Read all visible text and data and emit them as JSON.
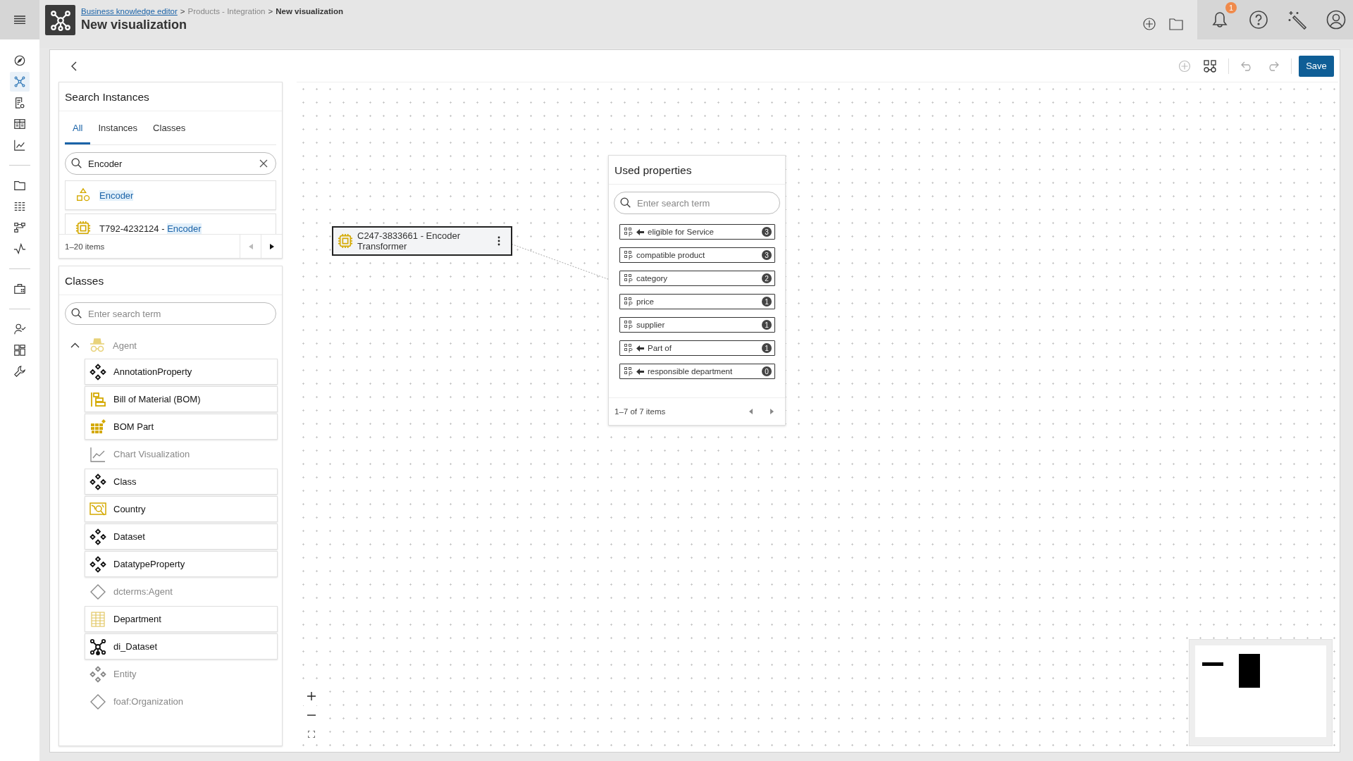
{
  "app_bar": {
    "breadcrumbs": [
      {
        "kind": "link",
        "label": "Business knowledge editor"
      },
      {
        "kind": "separator",
        "label": ">"
      },
      {
        "kind": "text",
        "label": "Products - Integration"
      },
      {
        "kind": "separator",
        "label": ">"
      },
      {
        "kind": "current",
        "label": "New visualization"
      }
    ],
    "title": "New visualization",
    "notification_count": "1"
  },
  "nav_groups": [
    [
      {
        "kind": "compass",
        "selected": false
      },
      {
        "kind": "network",
        "selected": true
      },
      {
        "kind": "doc-eye",
        "selected": false
      },
      {
        "kind": "table",
        "selected": false
      },
      {
        "kind": "chart",
        "selected": false
      }
    ],
    [
      {
        "kind": "folder",
        "selected": false
      },
      {
        "kind": "filters",
        "selected": false
      },
      {
        "kind": "flow",
        "selected": false
      },
      {
        "kind": "pulse",
        "selected": false
      }
    ],
    [
      {
        "kind": "briefcase",
        "selected": false
      }
    ],
    [
      {
        "kind": "user-check",
        "selected": false
      },
      {
        "kind": "widgets",
        "selected": false
      },
      {
        "kind": "wrench",
        "selected": false
      }
    ]
  ],
  "toolbar": {
    "save": "Save"
  },
  "search_instances": {
    "title": "Search Instances",
    "tabs": [
      {
        "label": "All",
        "selected": true
      },
      {
        "label": "Instances",
        "selected": false
      },
      {
        "label": "Classes",
        "selected": false
      }
    ],
    "search": {
      "value": "Encoder"
    },
    "results": [
      {
        "kind": "shapes",
        "parts": [
          {
            "text": "Encoder",
            "match": true
          }
        ]
      },
      {
        "kind": "chip",
        "parts": [
          {
            "text": "T792-4232124 - ",
            "match": false
          },
          {
            "text": "Encoder",
            "match": true
          }
        ]
      }
    ],
    "pager": "1–20 items"
  },
  "classes": {
    "title": "Classes",
    "search": {
      "placeholder": "Enter search term"
    },
    "tree": [
      {
        "label": "Agent",
        "kind": "agent",
        "enabled": false,
        "expanded": true,
        "children": [
          {
            "label": "AnnotationProperty",
            "kind": "diamonds",
            "enabled": true
          },
          {
            "label": "Bill of Material (BOM)",
            "kind": "bom",
            "enabled": true
          },
          {
            "label": "BOM Part",
            "kind": "bom-part",
            "enabled": true
          },
          {
            "label": "Chart Visualization",
            "kind": "chart",
            "enabled": false
          },
          {
            "label": "Class",
            "kind": "diamonds",
            "enabled": true
          },
          {
            "label": "Country",
            "kind": "country",
            "enabled": true
          },
          {
            "label": "Dataset",
            "kind": "diamonds",
            "enabled": true
          },
          {
            "label": "DatatypeProperty",
            "kind": "diamonds",
            "enabled": true
          },
          {
            "label": "dcterms:Agent",
            "kind": "diamond",
            "enabled": false
          },
          {
            "label": "Department",
            "kind": "department",
            "enabled": true
          },
          {
            "label": "di_Dataset",
            "kind": "network",
            "enabled": true
          },
          {
            "label": "Entity",
            "kind": "diamonds",
            "enabled": false
          },
          {
            "label": "foaf:Organization",
            "kind": "diamond",
            "enabled": false
          }
        ]
      }
    ]
  },
  "canvas": {
    "node": {
      "label": "C247-3833661 - Encoder Transformer",
      "kind": "chip"
    },
    "used_properties": {
      "title": "Used properties",
      "search": {
        "placeholder": "Enter search term"
      },
      "items": [
        {
          "label": "eligible for Service",
          "inverse": true,
          "count": "3"
        },
        {
          "label": "compatible product",
          "inverse": false,
          "count": "3"
        },
        {
          "label": "category",
          "inverse": false,
          "count": "2"
        },
        {
          "label": "price",
          "inverse": false,
          "count": "1"
        },
        {
          "label": "supplier",
          "inverse": false,
          "count": "1"
        },
        {
          "label": "Part of",
          "inverse": true,
          "count": "1"
        },
        {
          "label": "responsible department",
          "inverse": true,
          "count": "0"
        }
      ],
      "pager": "1–7 of 7 items"
    }
  }
}
